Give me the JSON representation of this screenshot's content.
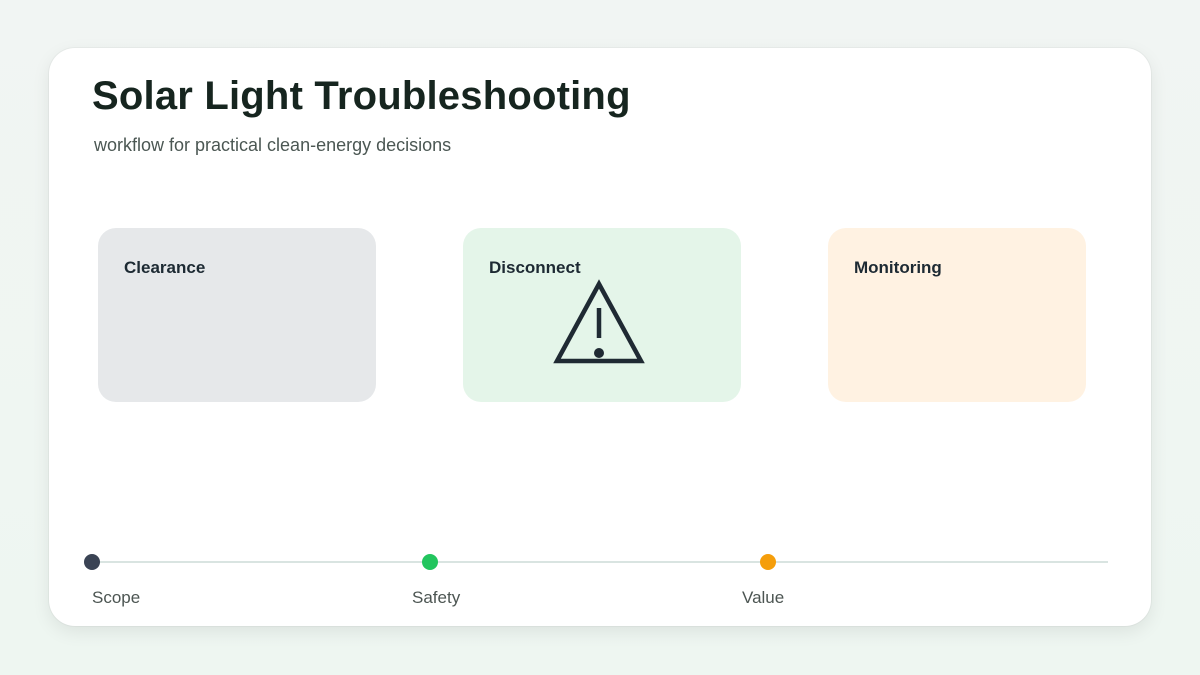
{
  "header": {
    "title": "Solar Light Troubleshooting",
    "subtitle": "workflow for practical clean-energy decisions"
  },
  "steps": [
    {
      "label": "Clearance",
      "color": "#e6e8ea"
    },
    {
      "label": "Disconnect",
      "color": "#e4f5e9",
      "icon": "warning-triangle-icon"
    },
    {
      "label": "Monitoring",
      "color": "#fff2e2"
    }
  ],
  "timeline": {
    "milestones": [
      {
        "label": "Scope",
        "color": "#3a4354"
      },
      {
        "label": "Safety",
        "color": "#22c55e"
      },
      {
        "label": "Value",
        "color": "#f59e0b"
      }
    ]
  }
}
